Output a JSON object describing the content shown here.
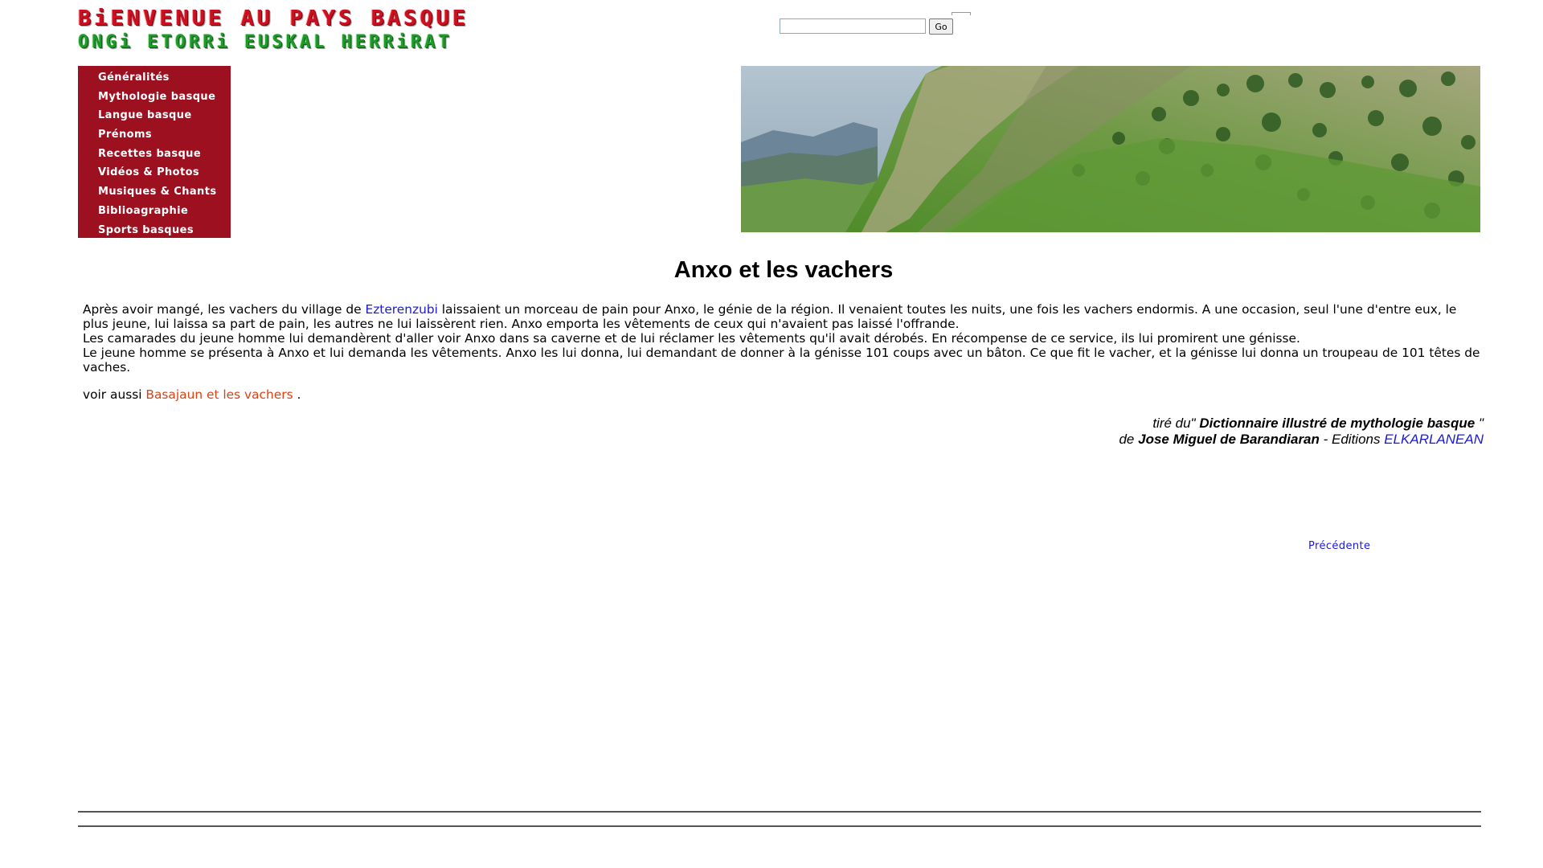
{
  "header": {
    "logo_line1": "BiENVENUE AU PAYS BASQUE",
    "logo_line2": "ONGi ETORRi EUSKAL HERRiRAT"
  },
  "search": {
    "value": "",
    "button_label": "Go"
  },
  "sidebar": {
    "items": [
      {
        "label": "Généralités"
      },
      {
        "label": "Mythologie basque"
      },
      {
        "label": "Langue basque"
      },
      {
        "label": "Prénoms"
      },
      {
        "label": "Recettes basque"
      },
      {
        "label": "Vidéos & Photos"
      },
      {
        "label": "Musiques & Chants"
      },
      {
        "label": "Biblioagraphie"
      },
      {
        "label": "Sports basques"
      }
    ]
  },
  "article": {
    "title": "Anxo et les vachers",
    "p1_before": "Après avoir mangé, les vachers du village de ",
    "p1_link": "Ezterenzubi",
    "p1_after": " laissaient un morceau de pain pour Anxo, le génie de la région. Il venaient toutes les nuits, une fois les vachers endormis. A une occasion, seul l'une d'entre eux, le plus jeune, lui laissa sa part de pain, les autres ne lui laissèrent rien. Anxo emporta les vêtements de ceux qui n'avaient pas laissé l'offrande.",
    "p2": "Les camarades du jeune homme lui demandèrent d'aller voir Anxo dans sa caverne et de lui réclamer les vêtements qu'il avait dérobés. En récompense de ce service, ils lui promirent une génisse.",
    "p3": "Le jeune homme se présenta à Anxo et lui demanda les vêtements. Anxo les lui donna, lui demandant de donner à la génisse 101 coups avec un bâton. Ce que fit le vacher, et la génisse lui donna un troupeau de 101 têtes de vaches.",
    "see_also_prefix": "voir aussi ",
    "see_also_link": "Basajaun et les vachers",
    "see_also_suffix": " ."
  },
  "source": {
    "line1_prefix": "tiré du\" ",
    "book_title": "Dictionnaire illustré de mythologie basque",
    "line1_suffix": " \"",
    "line2_prefix": "de ",
    "author": "Jose Miguel de Barandiaran",
    "line2_middle": " - Editions ",
    "publisher": "ELKARLANEAN"
  },
  "navigation": {
    "previous_label": "Précédente"
  },
  "colors": {
    "sidebar_bg": "#9c1020",
    "link_blue": "#1a1ad8",
    "link_red": "#e04010",
    "logo_red": "#cc1020",
    "logo_green": "#1f9a2a"
  }
}
